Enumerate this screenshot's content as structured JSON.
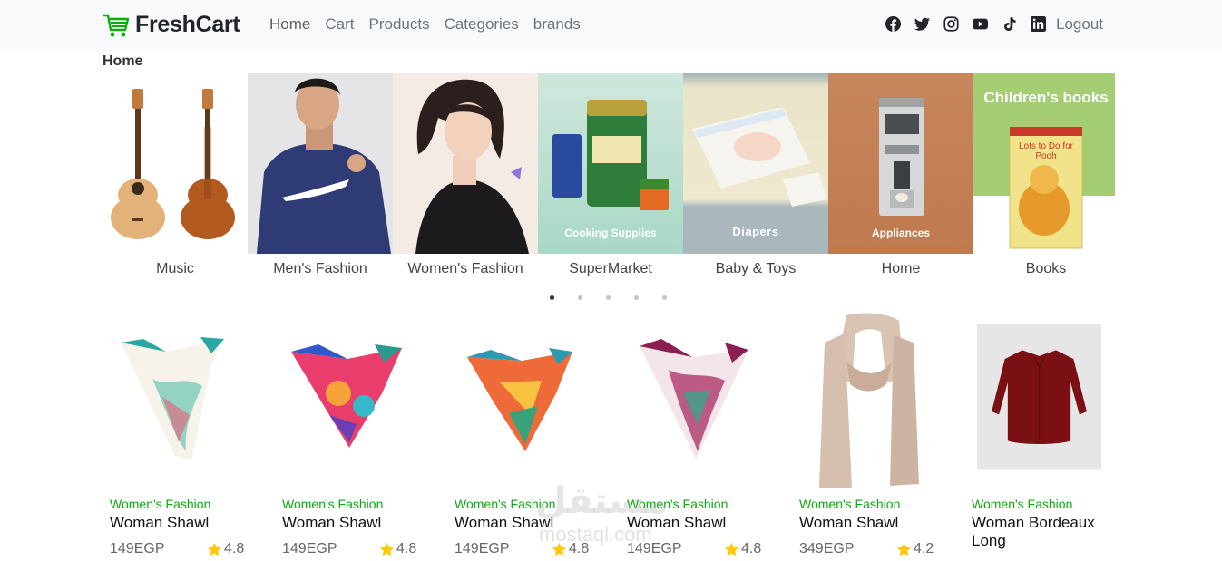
{
  "brand": {
    "name": "FreshCart",
    "logo_icon": "cart-icon",
    "accent": "#0aad0a"
  },
  "nav": {
    "links": [
      "Home",
      "Cart",
      "Products",
      "Categories",
      "brands"
    ],
    "social_icons": [
      "facebook-icon",
      "twitter-icon",
      "instagram-icon",
      "youtube-icon",
      "tiktok-icon",
      "linkedin-icon"
    ],
    "logout": "Logout"
  },
  "page": {
    "title": "Home"
  },
  "categories": [
    {
      "label": "Music"
    },
    {
      "label": "Men's Fashion"
    },
    {
      "label": "Women's Fashion"
    },
    {
      "label": "SuperMarket",
      "image_text": "Cooking Supplies"
    },
    {
      "label": "Baby & Toys",
      "image_text": "Diapers"
    },
    {
      "label": "Home",
      "image_text": "Appliances"
    },
    {
      "label": "Books",
      "image_text": "Children's books",
      "book_text": "Lots to Do for Pooh"
    }
  ],
  "slider": {
    "dot_count": 5,
    "active_dot": 0
  },
  "products": [
    {
      "category": "Women's Fashion",
      "title": "Woman Shawl",
      "price": "149EGP",
      "rating": "4.8"
    },
    {
      "category": "Women's Fashion",
      "title": "Woman Shawl",
      "price": "149EGP",
      "rating": "4.8"
    },
    {
      "category": "Women's Fashion",
      "title": "Woman Shawl",
      "price": "149EGP",
      "rating": "4.8"
    },
    {
      "category": "Women's Fashion",
      "title": "Woman Shawl",
      "price": "149EGP",
      "rating": "4.8"
    },
    {
      "category": "Women's Fashion",
      "title": "Woman Shawl",
      "price": "349EGP",
      "rating": "4.2"
    },
    {
      "category": "Women's Fashion",
      "title": "Woman Bordeaux Long",
      "price": "",
      "rating": ""
    }
  ],
  "watermark": {
    "text": "مستقل",
    "sub": "mostaql.com"
  }
}
